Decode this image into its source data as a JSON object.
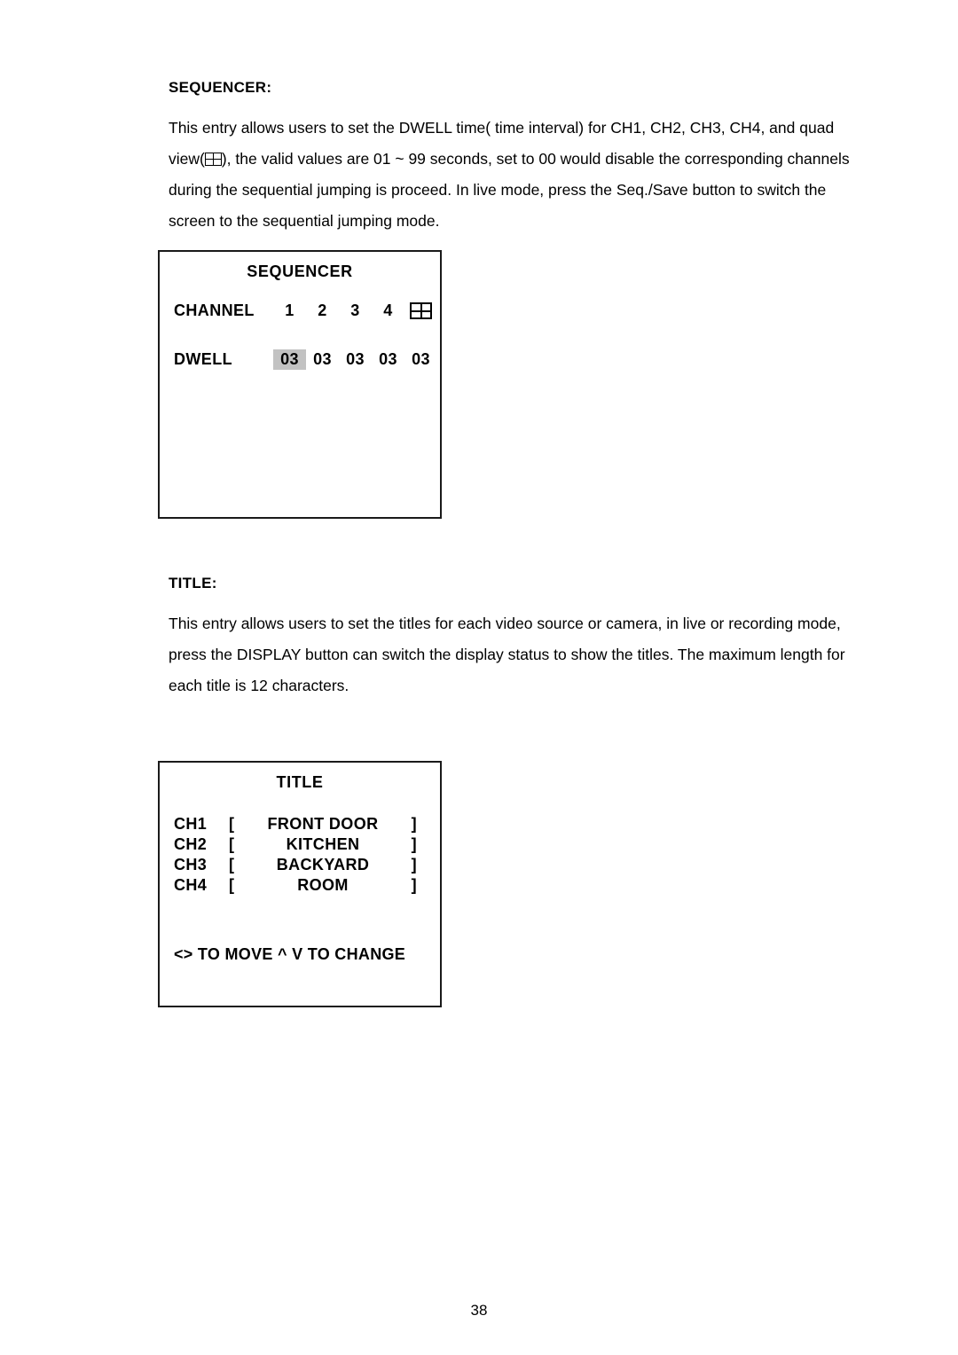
{
  "document": {
    "page_number": "38"
  },
  "sections": {
    "sequencer": {
      "heading": "SEQUENCER:",
      "paragraph_part_1": "This entry allows users to set the DWELL time( time interval) for CH1, CH2, CH3, CH4, and quad view(",
      "quad_icon_name": "quad-view-icon",
      "paragraph_part_2": "), the valid values are 01 ~ 99 seconds, set to 00 would disable the corresponding channels during the sequential jumping is proceed. In live mode, press the Seq./Save button to switch the screen to the sequential jumping mode."
    },
    "title": {
      "heading": "TITLE:",
      "paragraph": "This entry allows users to set the titles for each video source or camera, in live or recording mode, press the DISPLAY button can switch the display status to show the titles. The maximum length for each title is 12 characters."
    }
  },
  "sequencer_panel": {
    "title": "SEQUENCER",
    "channel_label": "CHANNEL",
    "channels": [
      "1",
      "2",
      "3",
      "4"
    ],
    "quad_channel_icon": "quad-view-icon",
    "dwell_label": "DWELL",
    "dwell_values": [
      "03",
      "03",
      "03",
      "03",
      "03"
    ],
    "selected_index": 0,
    "highlight_color": "#c2c2c2"
  },
  "title_panel": {
    "title": "TITLE",
    "rows": [
      {
        "channel": "CH1",
        "open": "[",
        "value": "FRONT DOOR",
        "close": "]"
      },
      {
        "channel": "CH2",
        "open": "[",
        "value": "KITCHEN",
        "close": "]"
      },
      {
        "channel": "CH3",
        "open": "[",
        "value": "BACKYARD",
        "close": "]"
      },
      {
        "channel": "CH4",
        "open": "[",
        "value": "ROOM",
        "close": "]"
      }
    ],
    "hint": "<> TO MOVE ^ V TO CHANGE"
  }
}
